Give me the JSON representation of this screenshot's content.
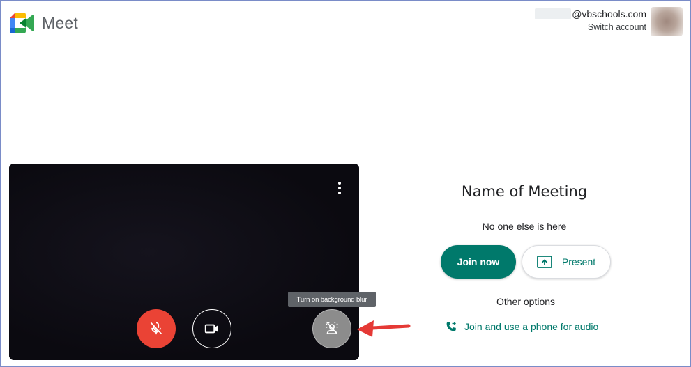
{
  "app": {
    "name": "Meet"
  },
  "account": {
    "email_suffix": "@vbschools.com",
    "switch_label": "Switch account"
  },
  "preview": {
    "mic_state": "muted",
    "tooltip": "Turn on background blur"
  },
  "meeting": {
    "title": "Name of Meeting",
    "status": "No one else is here",
    "join_label": "Join now",
    "present_label": "Present",
    "other_options_label": "Other options",
    "phone_label": "Join and use a phone for audio"
  },
  "colors": {
    "accent": "#00796b",
    "mic_off": "#ea4335",
    "annotation_arrow": "#e53935",
    "frame_border": "#7a8cc8"
  },
  "icons": {
    "logo": "google-meet-logo",
    "more": "more-vert-icon",
    "mic": "mic-off-icon",
    "camera": "videocam-icon",
    "blur": "background-blur-icon",
    "present": "present-to-all-icon",
    "phone": "phone-forwarded-icon"
  }
}
